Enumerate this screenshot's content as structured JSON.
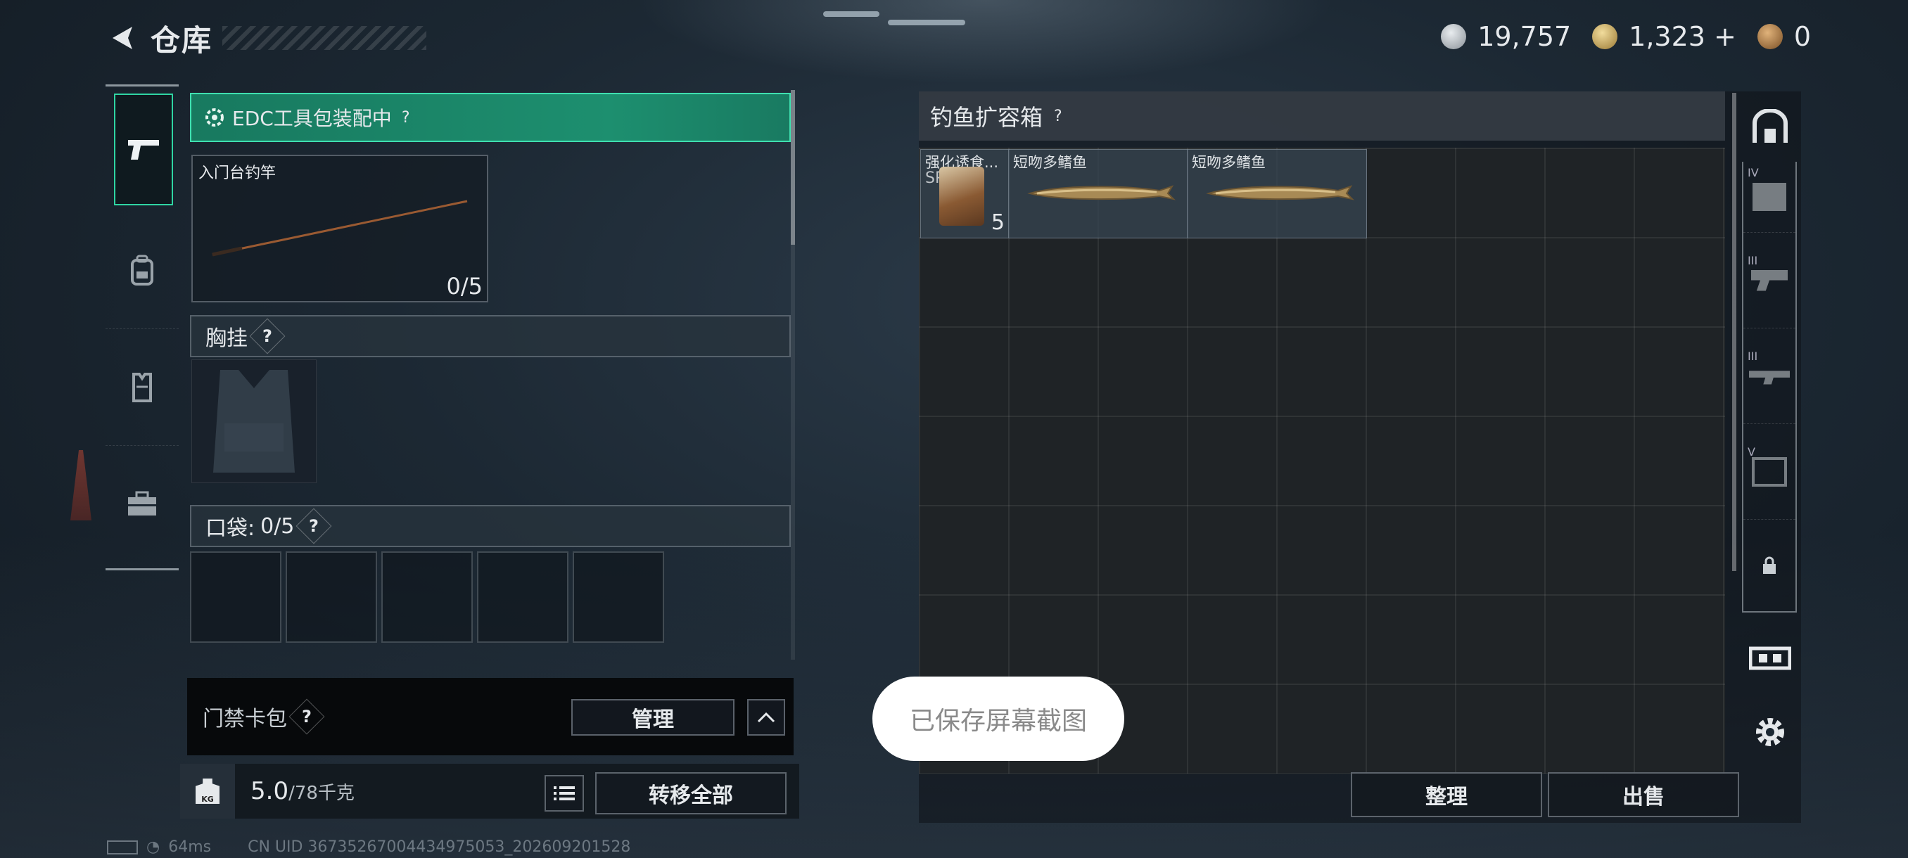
{
  "header": {
    "title": "仓库"
  },
  "currencies": [
    {
      "icon": "silver-coin-icon",
      "value": "19,757",
      "color": "#b9bfc6"
    },
    {
      "icon": "gold-triangle-coin-icon",
      "value": "1,323",
      "suffix": "+",
      "color": "#c8a960"
    },
    {
      "icon": "bronze-coin-icon",
      "value": "0",
      "color": "#b08450"
    }
  ],
  "left_tabs": [
    {
      "icon": "pistol-icon",
      "active": true
    },
    {
      "icon": "backpack-icon",
      "active": false
    },
    {
      "icon": "vest-icon",
      "active": false
    },
    {
      "icon": "toolbox-icon",
      "active": false
    }
  ],
  "left_panel": {
    "edc_label": "EDC工具包装配中",
    "rod": {
      "name": "入门台钓竿",
      "count": "0/5"
    },
    "chest_label": "胸挂",
    "pocket_label": "口袋:",
    "pocket_count": "0/5",
    "card_label": "门禁卡包",
    "manage_label": "管理",
    "weight_current": "5.0",
    "weight_max": "/78千克",
    "weight_icon_label": "KG",
    "transfer_label": "转移全部"
  },
  "right_panel": {
    "title": "钓鱼扩容箱",
    "items": [
      {
        "name": "强化诱食...",
        "sub": "SP",
        "count": "5"
      },
      {
        "name": "短吻多鳍鱼"
      },
      {
        "name": "短吻多鳍鱼"
      }
    ],
    "sort_label": "整理",
    "sell_label": "出售"
  },
  "right_sidebar": [
    {
      "icon": "case-tier-iv-icon",
      "tier": "IV"
    },
    {
      "icon": "gun-tier-iii-icon",
      "tier": "III"
    },
    {
      "icon": "rifle-tier-iii-icon",
      "tier": "III"
    },
    {
      "icon": "armor-tier-v-icon",
      "tier": "V"
    },
    {
      "icon": "lock-icon"
    }
  ],
  "toast": "已保存屏幕截图",
  "status": {
    "ping": "64ms",
    "uid": "CN UID 3673526700443497505​3_202609201528"
  }
}
